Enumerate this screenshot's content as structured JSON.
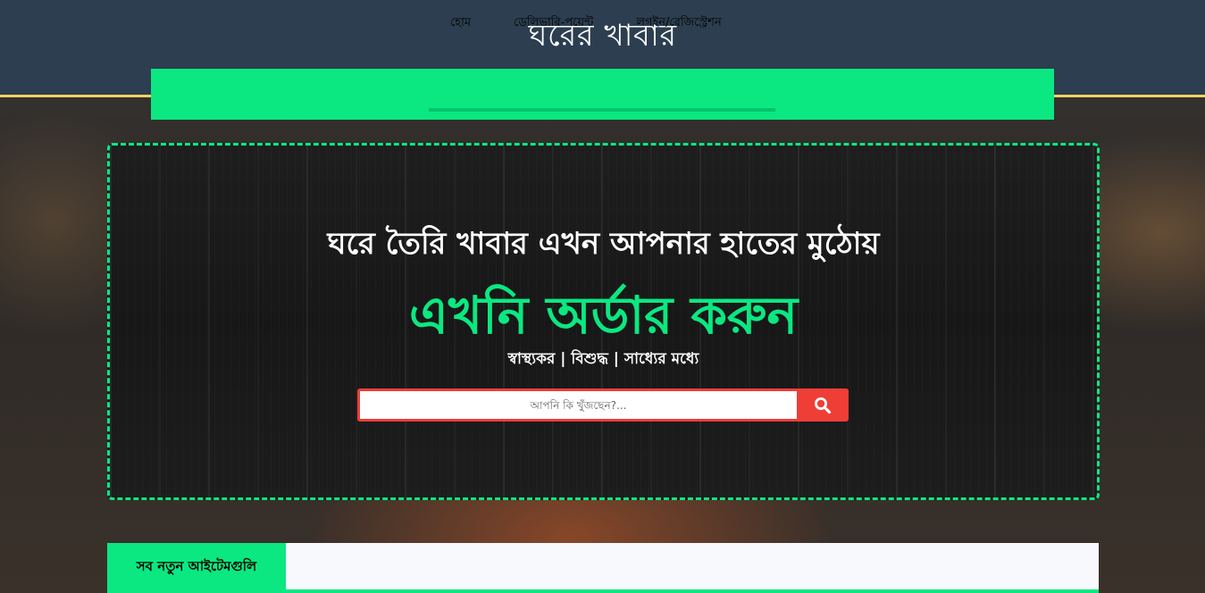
{
  "site": {
    "title": "ঘরের খাবার"
  },
  "nav": {
    "items": [
      {
        "label": "হোম"
      },
      {
        "label": "ডেলিভারি-পয়েন্ট"
      },
      {
        "label": "লগইন/রেজিস্ট্রেশন"
      }
    ]
  },
  "hero": {
    "headline": "ঘরে তৈরি খাবার এখন আপনার হাতের মুঠোয়",
    "cta": "এখনি অর্ডার করুন",
    "tagline": "স্বাস্থ্যকর | বিশুদ্ধ | সাধ্যের মধ্যে"
  },
  "search": {
    "placeholder": "আপনি কি খুঁজছেন?...",
    "value": "",
    "icon": "search-icon"
  },
  "section": {
    "title": "সব নতুন আইটেমগুলি"
  },
  "colors": {
    "accent": "#0be881",
    "header_bg": "#2c3e50",
    "header_border": "#f4d35e",
    "search_button": "#ef3e36"
  }
}
